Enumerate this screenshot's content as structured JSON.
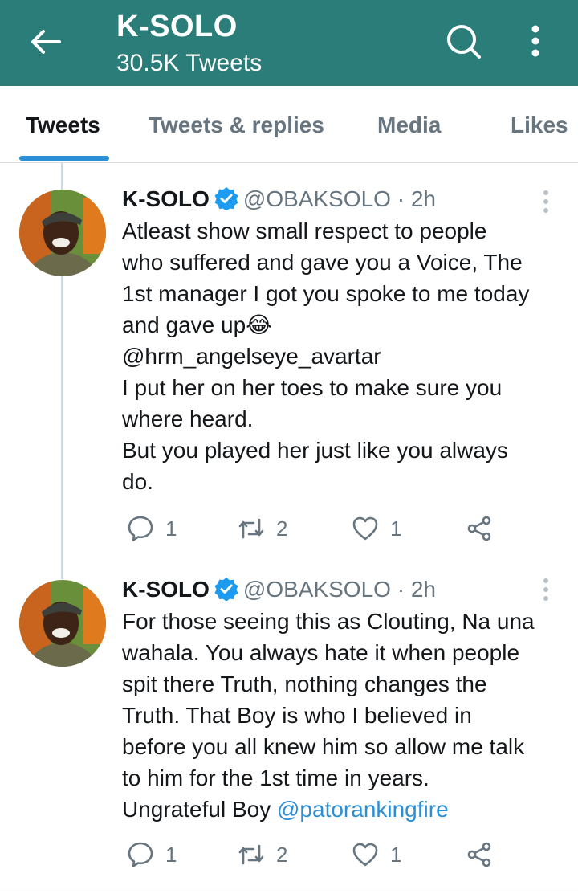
{
  "profile": {
    "name": "K-SOLO",
    "tweet_count": "30.5K Tweets"
  },
  "icons": {
    "back": "arrow-left-icon",
    "search": "search-icon",
    "more": "more-vertical-icon",
    "verified": "verified-badge-icon",
    "reply": "reply-icon",
    "retweet": "retweet-icon",
    "like": "heart-icon",
    "share": "share-icon"
  },
  "colors": {
    "header": "#2a7d78",
    "accent": "#2b8fd6",
    "muted": "#66757f"
  },
  "tabs": [
    {
      "label": "Tweets",
      "active": true
    },
    {
      "label": "Tweets & replies",
      "active": false
    },
    {
      "label": "Media",
      "active": false
    },
    {
      "label": "Likes",
      "active": false
    }
  ],
  "tweets": [
    {
      "name": "K-SOLO",
      "handle": "@OBAKSOLO",
      "separator": "·",
      "time": "2h",
      "lines": [
        "Atleast show small respect to people",
        "who suffered and gave you a Voice, The",
        "1st manager I got you spoke to me today",
        "and gave up😂",
        "@hrm_angelseye_avartar",
        "I put her on her toes to make sure you",
        "where heard.",
        "But you played her just like you always",
        "do."
      ],
      "replies": "1",
      "retweets": "2",
      "likes": "1"
    },
    {
      "name": "K-SOLO",
      "handle": "@OBAKSOLO",
      "separator": "·",
      "time": "2h",
      "lines": [
        "For those seeing this as Clouting, Na una",
        "wahala. You always hate it when people",
        "spit there Truth, nothing changes the",
        "Truth. That Boy is who I believed in",
        "before you all knew him so allow me talk",
        "to him for the 1st time in years.",
        "Ungrateful Boy "
      ],
      "mention": "@patorankingfire",
      "replies": "1",
      "retweets": "2",
      "likes": "1"
    }
  ]
}
